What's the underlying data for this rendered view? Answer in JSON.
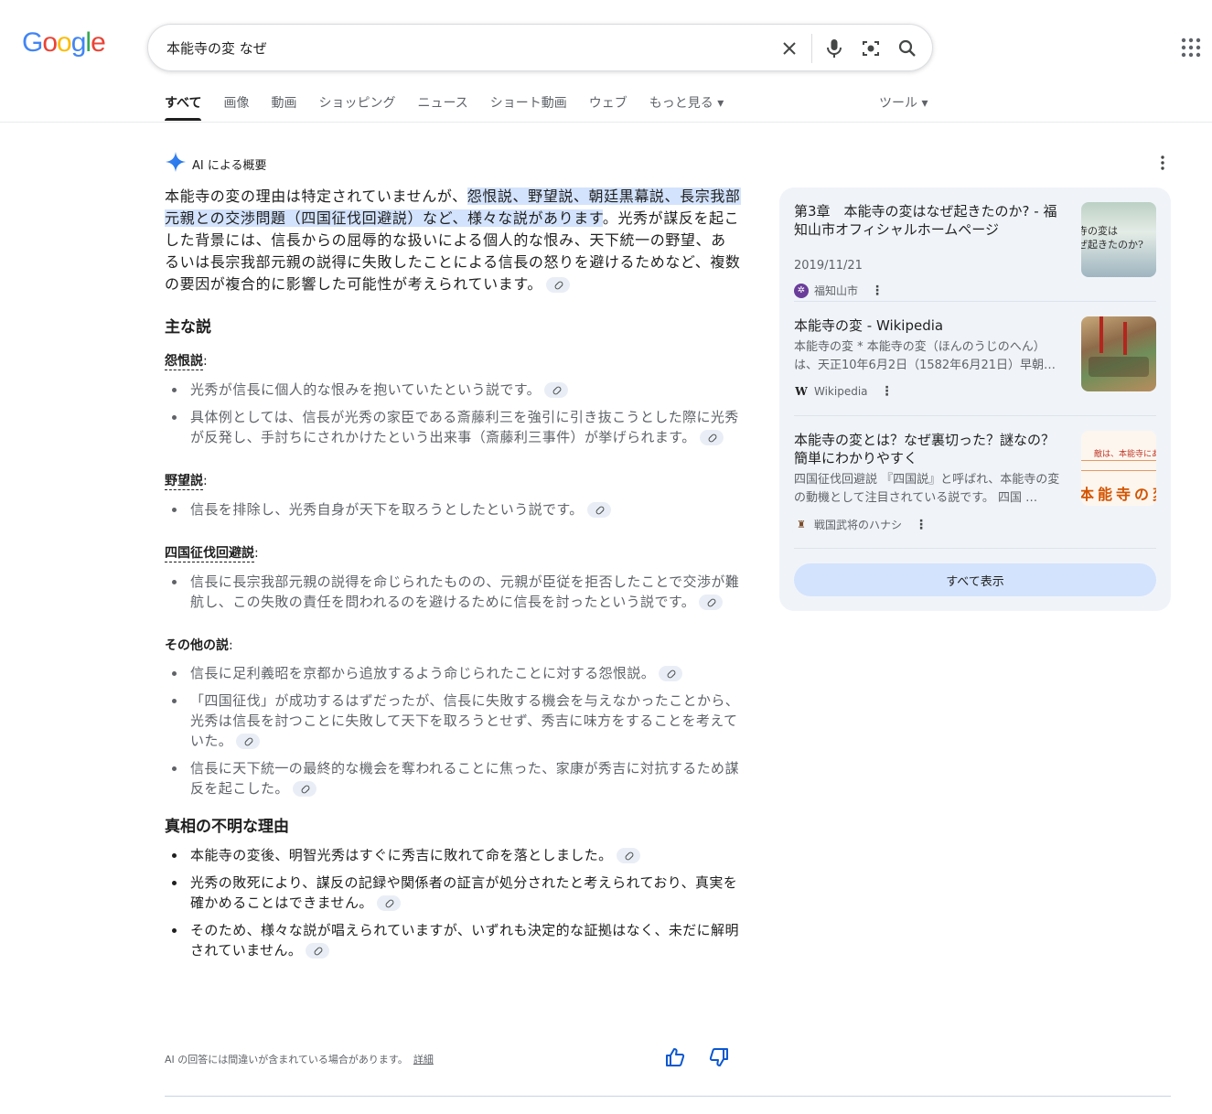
{
  "logo": [
    "G",
    "o",
    "o",
    "g",
    "l",
    "e"
  ],
  "search": {
    "query": "本能寺の変 なぜ"
  },
  "tabs": [
    "すべて",
    "画像",
    "動画",
    "ショッピング",
    "ニュース",
    "ショート動画",
    "ウェブ",
    "もっと見る ▾"
  ],
  "tools_label": "ツール ▾",
  "ai": {
    "heading": "AI による概要",
    "lead_pre": "本能寺の変の理由は特定されていませんが、",
    "lead_highlight": "怨恨説、野望説、朝廷黒幕説、長宗我部元親との交渉問題（四国征伐回避説）など、様々な説があります",
    "lead_post": "。光秀が謀反を起こした背景には、信長からの屈辱的な扱いによる個人的な恨み、天下統一の野望、あるいは長宗我部元親の説得に失敗したことによる信長の怒りを避けるためなど、複数の要因が複合的に影響した可能性が考えられています。",
    "section1": "主な説",
    "s1_title": "怨恨説",
    "s1_items": [
      "光秀が信長に個人的な恨みを抱いていたという説です。",
      "具体例としては、信長が光秀の家臣である斎藤利三を強引に引き抜こうとした際に光秀が反発し、手討ちにされかけたという出来事（斎藤利三事件）が挙げられます。"
    ],
    "s2_title": "野望説",
    "s2_items": [
      "信長を排除し、光秀自身が天下を取ろうとしたという説です。"
    ],
    "s3_title": "四国征伐回避説",
    "s3_items": [
      "信長に長宗我部元親の説得を命じられたものの、元親が臣従を拒否したことで交渉が難航し、この失敗の責任を問われるのを避けるために信長を討ったという説です。"
    ],
    "s4_title": "その他の説",
    "s4_items": [
      "信長に足利義昭を京都から追放するよう命じられたことに対する怨恨説。",
      "「四国征伐」が成功するはずだったが、信長に失敗する機会を与えなかったことから、光秀は信長を討つことに失敗して天下を取ろうとせず、秀吉に味方をすることを考えていた。",
      "信長に天下統一の最終的な機会を奪われることに焦った、家康が秀吉に対抗するため謀反を起こした。"
    ],
    "section2": "真相の不明な理由",
    "sec2_items": [
      "本能寺の変後、明智光秀はすぐに秀吉に敗れて命を落としました。",
      "光秀の敗死により、謀反の記録や関係者の証言が処分されたと考えられており、真実を確かめることはできません。",
      "そのため、様々な説が唱えられていますが、いずれも決定的な証拠はなく、未だに解明されていません。"
    ],
    "disclaimer": "AI の回答には間違いが含まれている場合があります。",
    "details_link": "詳細"
  },
  "sources": [
    {
      "title": "第3章　本能寺の変はなぜ起きたのか? - 福知山市オフィシャルホームページ",
      "date": "2019/11/21",
      "site": "福知山市",
      "img_text": "寺の変は\nぜ起きたのか?"
    },
    {
      "title": "本能寺の変 - Wikipedia",
      "snippet": "本能寺の変 * 本能寺の変（ほんのうじのへん）は、天正10年6月2日（1582年6月21日）早朝…",
      "site": "Wikipedia"
    },
    {
      "title": "本能寺の変とは？なぜ裏切った？謎なの？簡単にわかりやすく",
      "snippet": "四国征伐回避説 『四国説』と呼ばれ、本能寺の変の動機として注目されている説です。 四国 …",
      "site": "戦国武将のハナシ",
      "img_top": "敵は、本能寺にあり",
      "img_text": "本能寺の変"
    }
  ],
  "show_all": "すべて表示",
  "colors": {
    "accent": "#0b57d0",
    "highlight": "#d3e3fd",
    "panel": "#f0f4f9"
  }
}
